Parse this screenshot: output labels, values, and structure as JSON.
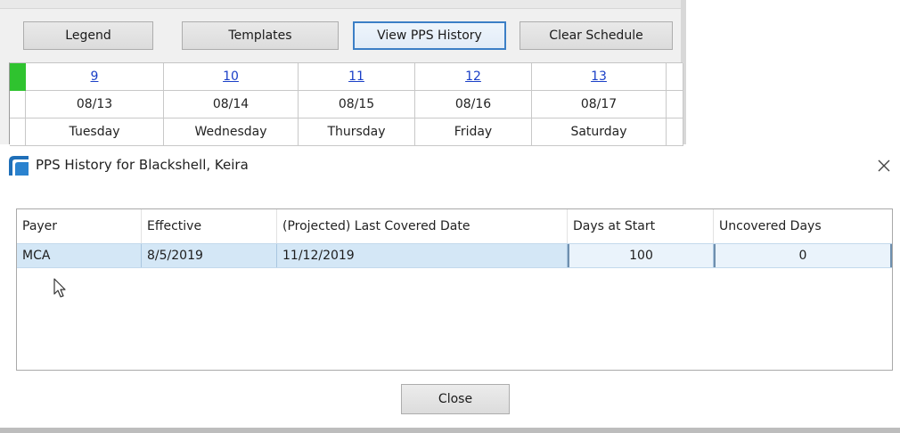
{
  "toolbar": {
    "legend_label": "Legend",
    "templates_label": "Templates",
    "view_pps_history_label": "View PPS History",
    "clear_schedule_label": "Clear Schedule"
  },
  "schedule": {
    "days": [
      {
        "num": "9",
        "date": "08/13",
        "weekday": "Tuesday"
      },
      {
        "num": "10",
        "date": "08/14",
        "weekday": "Wednesday"
      },
      {
        "num": "11",
        "date": "08/15",
        "weekday": "Thursday"
      },
      {
        "num": "12",
        "date": "08/16",
        "weekday": "Friday"
      },
      {
        "num": "13",
        "date": "08/17",
        "weekday": "Saturday"
      }
    ],
    "status_color": "#2fc32f"
  },
  "dialog": {
    "title": "PPS History for Blackshell, Keira",
    "close_icon": "close-icon",
    "columns": [
      "Payer",
      "Effective",
      "(Projected) Last Covered Date",
      "Days at Start",
      "Uncovered Days"
    ],
    "rows": [
      {
        "payer": "MCA",
        "effective": "8/5/2019",
        "last_covered": "11/12/2019",
        "days_at_start": "100",
        "uncovered_days": "0"
      }
    ],
    "close_label": "Close",
    "selection_color": "#d4e7f6"
  }
}
